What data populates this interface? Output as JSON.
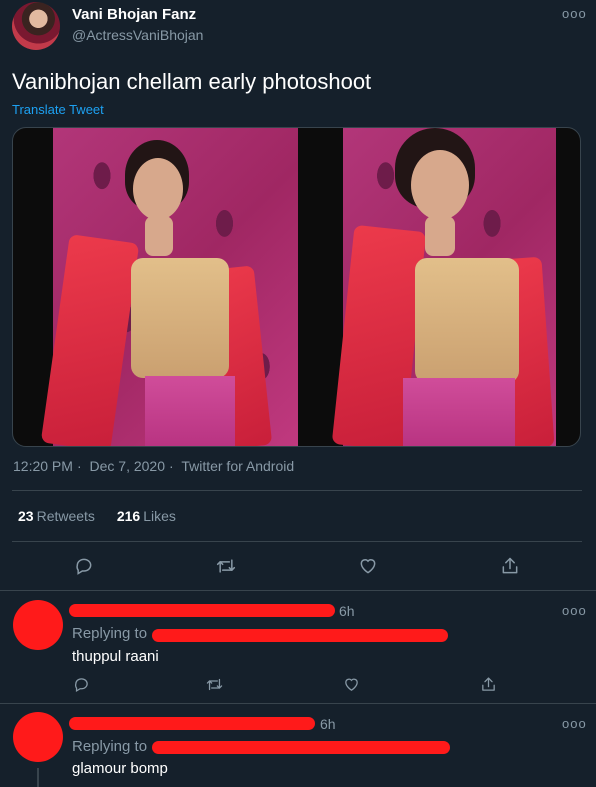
{
  "tweet": {
    "display_name": "Vani Bhojan Fanz",
    "handle": "@ActressVaniBhojan",
    "text": "Vanibhojan chellam early photoshoot",
    "translate_label": "Translate Tweet",
    "time": "12:20 PM",
    "date": "Dec 7, 2020",
    "source": "Twitter for Android",
    "retweets_count": "23",
    "retweets_label": "Retweets",
    "likes_count": "216",
    "likes_label": "Likes",
    "more_label": "ooo"
  },
  "actions": [
    "reply-icon",
    "retweet-icon",
    "like-icon",
    "share-icon"
  ],
  "replies": [
    {
      "time": "6h",
      "replying_label": "Replying to",
      "text": "thuppul raani",
      "more_label": "ooo"
    },
    {
      "time": "6h",
      "replying_label": "Replying to",
      "text": "glamour bomp",
      "more_label": "ooo"
    }
  ],
  "colors": {
    "background": "#15202b",
    "secondary_text": "#8899a6",
    "link": "#1da1f2",
    "divider": "#38444d",
    "redaction": "#ff1a1a"
  }
}
